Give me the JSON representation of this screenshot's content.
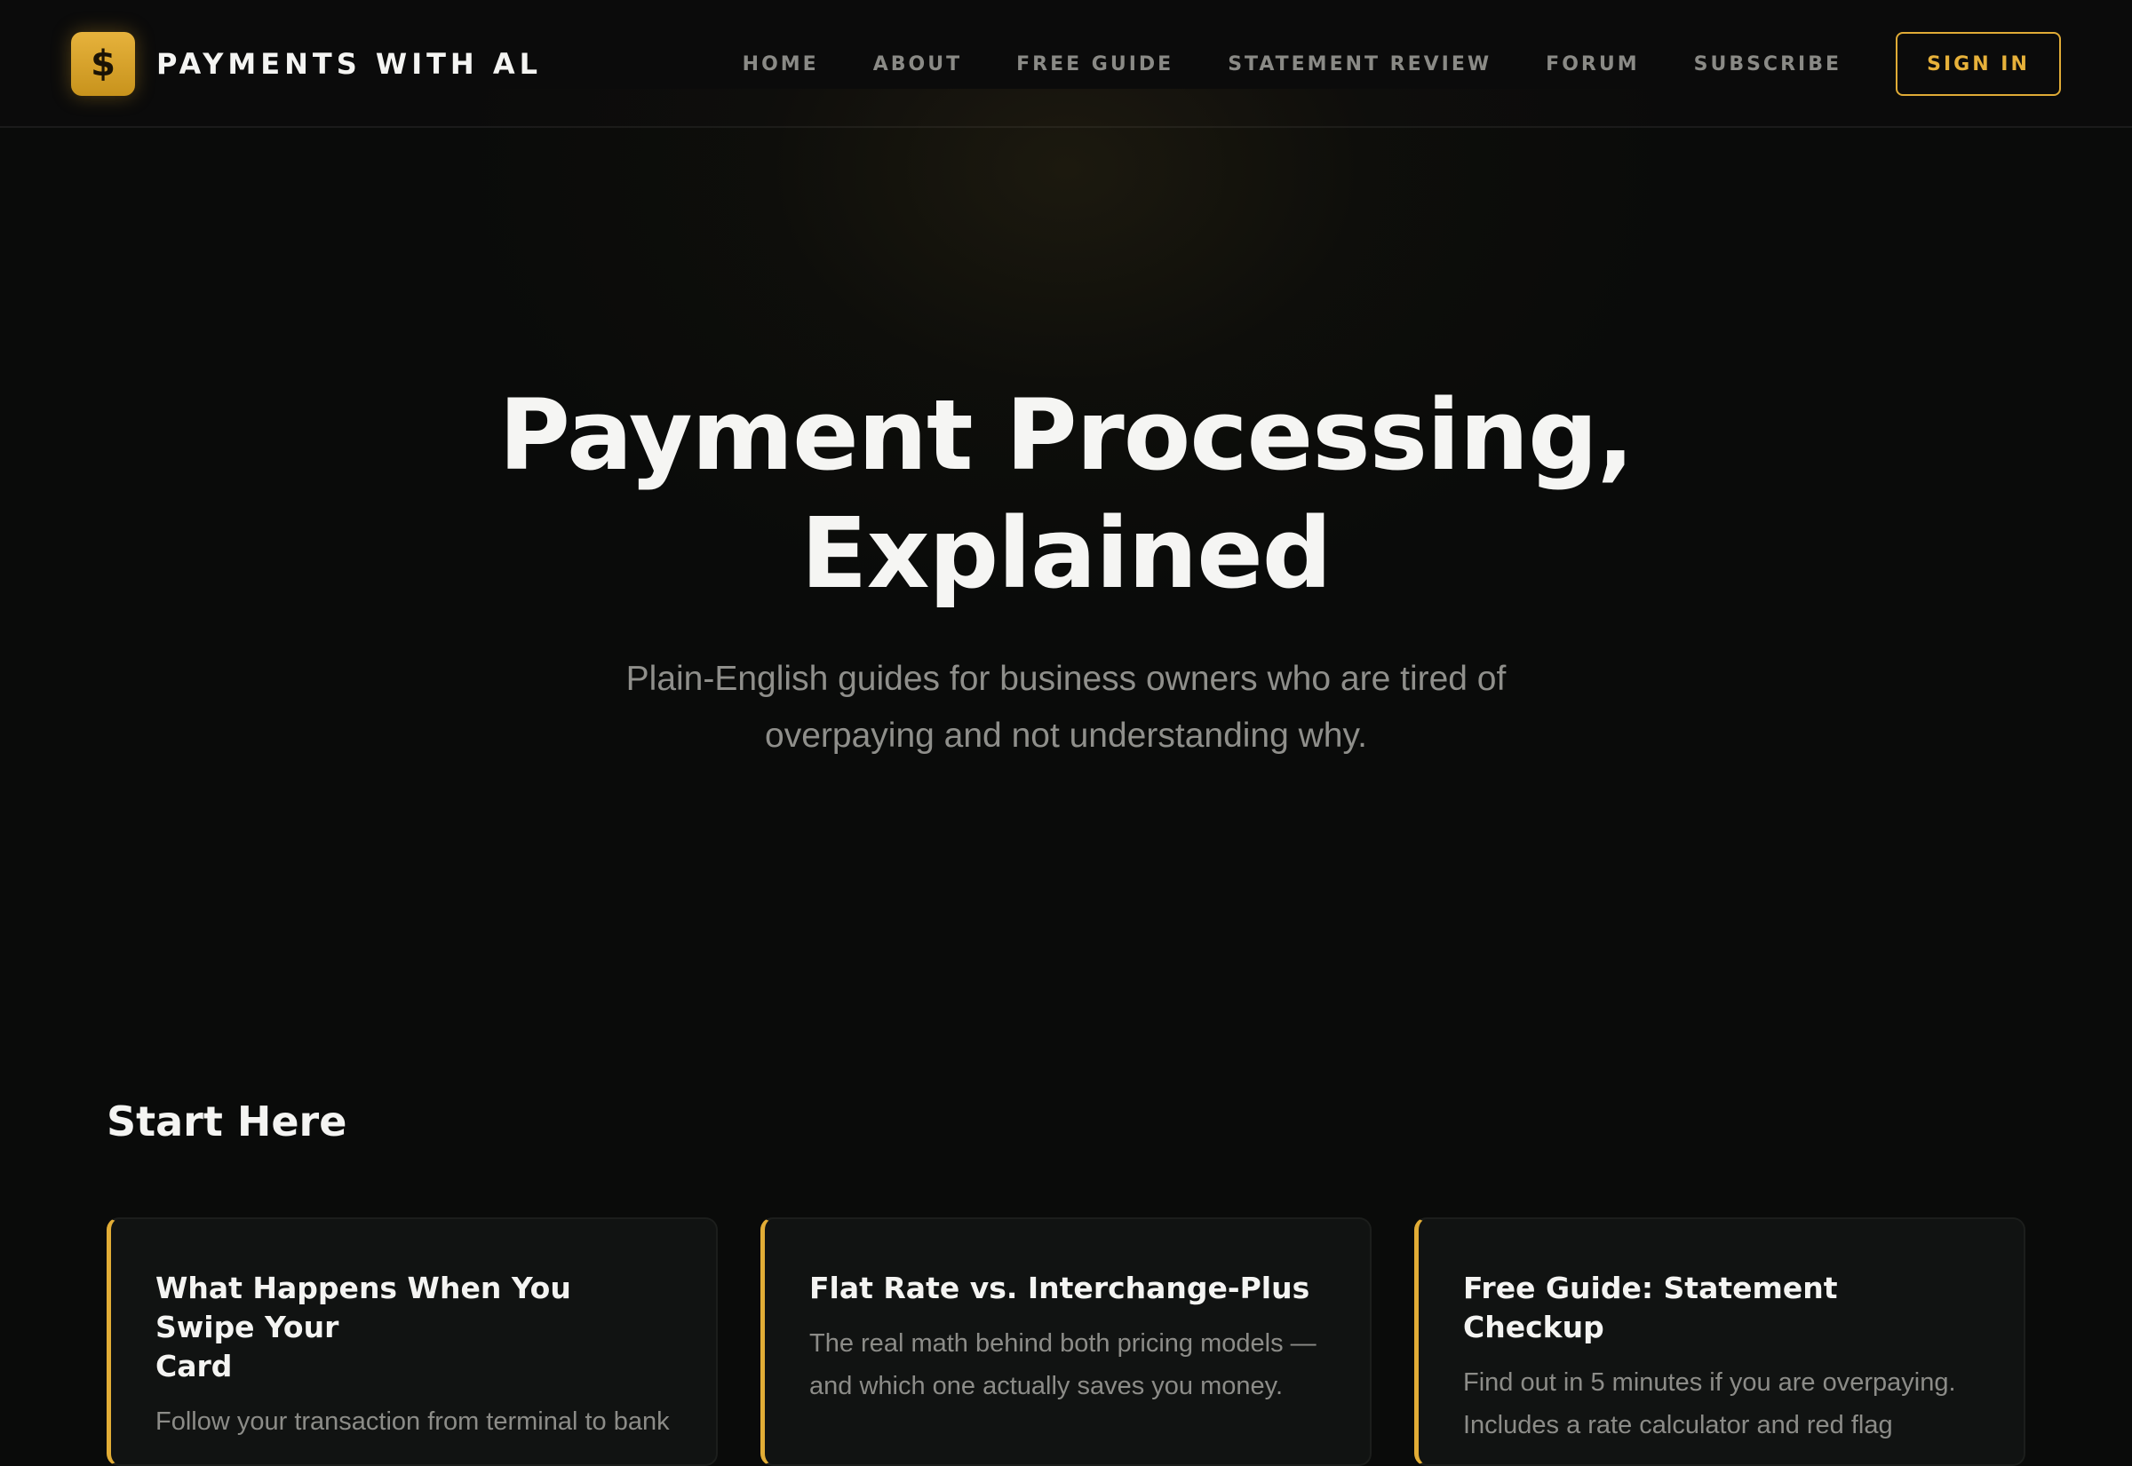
{
  "brand": {
    "logo_icon": "dollar-sign-icon",
    "logo_glyph": "$",
    "name": "PAYMENTS WITH AL",
    "accent_color": "#e2ad36"
  },
  "nav": {
    "links": [
      {
        "label": "HOME"
      },
      {
        "label": "ABOUT"
      },
      {
        "label": "FREE GUIDE"
      },
      {
        "label": "STATEMENT REVIEW"
      },
      {
        "label": "FORUM"
      },
      {
        "label": "SUBSCRIBE"
      }
    ],
    "sign_in_label": "SIGN IN"
  },
  "hero": {
    "title_line1": "Payment Processing,",
    "title_line2": "Explained",
    "subtitle_line1": "Plain-English guides for business owners who are tired of",
    "subtitle_line2": "overpaying and not understanding why."
  },
  "start_here": {
    "heading": "Start Here",
    "cards": [
      {
        "title_line1": "What Happens When You Swipe Your",
        "title_line2": "Card",
        "desc_line1": "Follow your transaction from terminal to bank"
      },
      {
        "title_line1": "Flat Rate vs. Interchange-Plus",
        "desc_line1": "The real math behind both pricing models —",
        "desc_line2": "and which one actually saves you money."
      },
      {
        "title_line1": "Free Guide: Statement Checkup",
        "desc_line1": "Find out in 5 minutes if you are overpaying.",
        "desc_line2": "Includes a rate calculator and red flag"
      }
    ]
  }
}
